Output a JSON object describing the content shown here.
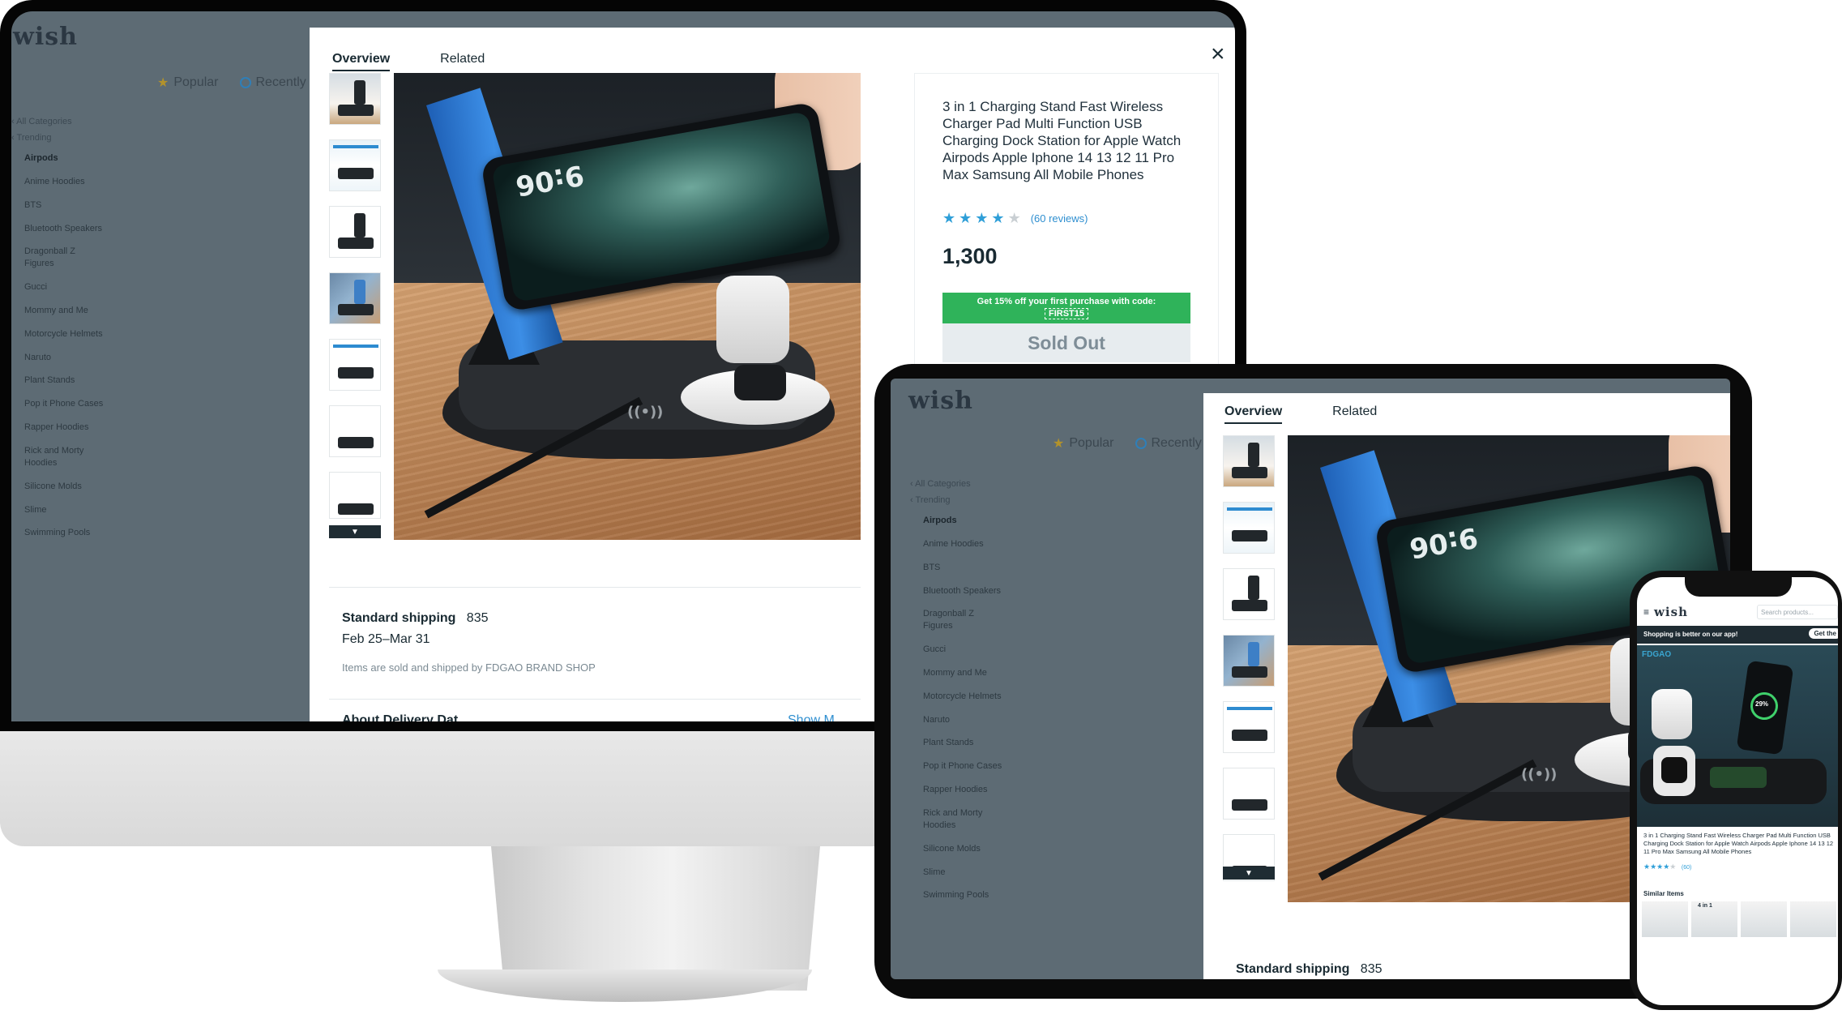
{
  "brand": {
    "logo": "wish"
  },
  "nav": {
    "popular": "Popular",
    "recently": "Recently"
  },
  "categories": {
    "all": "All Categories",
    "trending": "Trending",
    "items": [
      "Airpods",
      "Anime Hoodies",
      "BTS",
      "Bluetooth Speakers",
      "Dragonball Z Figures",
      "Gucci",
      "Mommy and Me",
      "Motorcycle Helmets",
      "Naruto",
      "Plant Stands",
      "Pop it Phone Cases",
      "Rapper Hoodies",
      "Rick and Morty Hoodies",
      "Silicone Molds",
      "Slime",
      "Swimming Pools"
    ]
  },
  "modal": {
    "tabs": [
      "Overview",
      "Related"
    ],
    "close": "×"
  },
  "product": {
    "title": "3 in 1 Charging Stand Fast Wireless Charger Pad Multi Function USB Charging Dock Station for Apple Watch Airpods Apple Iphone 14 13 12 11 Pro Max Samsung All Mobile Phones",
    "rating": 4,
    "reviews": "(60 reviews)",
    "price": "1,300",
    "promo_text": "Get 15% off your first purchase with code:",
    "promo_code": "FIRST15",
    "sold_out": "Sold Out",
    "photo_time": "9:06",
    "brand_tag": "FDGAO"
  },
  "shipping": {
    "label": "Standard shipping",
    "price": "835",
    "dates": "Feb 25–Mar 31",
    "sold_by": "Items are sold and shipped by FDGAO BRAND SHOP",
    "about_partial": "About Delivery Dat",
    "show_more_partial": "Show M"
  },
  "mobile": {
    "search_placeholder": "Search products...",
    "banner": "Shopping is better on our app!",
    "get_app": "Get the",
    "title": "3 in 1 Charging Stand Fast Wireless Charger Pad Multi Function USB Charging Dock Station for Apple Watch Airpods Apple Iphone 14 13 12 11 Pro Max Samsung All Mobile Phones",
    "reviews": "(60)",
    "similar": "Similar Items",
    "tile_label": "4 in 1",
    "charge": "29%"
  },
  "colors": {
    "accent_blue": "#2f9fd8",
    "promo_green": "#2fb35a",
    "overlay": "#5d6b74",
    "dark": "#192a32"
  }
}
